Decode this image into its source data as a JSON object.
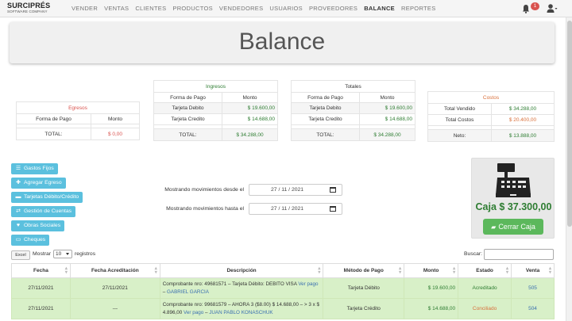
{
  "nav": {
    "brand_name": "SURCIPRÉS",
    "brand_tagline": "SOFTWARE COMPANY",
    "items": [
      "VENDER",
      "VENTAS",
      "CLIENTES",
      "PRODUCTOS",
      "VENDEDORES",
      "USUARIOS",
      "PROVEEDORES",
      "BALANCE",
      "REPORTES"
    ],
    "active": "BALANCE",
    "notification_count": "1"
  },
  "page_title": "Balance",
  "egresos": {
    "title": "Egresos",
    "col1": "Forma de Pago",
    "col2": "Monto",
    "total_label": "TOTAL:",
    "total_value": "$ 0,00"
  },
  "ingresos": {
    "title": "Ingresos",
    "col1": "Forma de Pago",
    "col2": "Monto",
    "rows": [
      {
        "forma": "Tarjeta Debito",
        "monto": "$ 19.600,00"
      },
      {
        "forma": "Tarjeta Credito",
        "monto": "$ 14.688,00"
      }
    ],
    "total_label": "TOTAL:",
    "total_value": "$ 34.288,00"
  },
  "totales": {
    "title": "Totales",
    "col1": "Forma de Pago",
    "col2": "Monto",
    "rows": [
      {
        "forma": "Tarjeta Debito",
        "monto": "$ 19.600,00"
      },
      {
        "forma": "Tarjeta Credito",
        "monto": "$ 14.688,00"
      }
    ],
    "total_label": "TOTAL:",
    "total_value": "$ 34.288,00"
  },
  "costos": {
    "title": "Costos",
    "rows": [
      {
        "label": "Total Vendido",
        "value": "$ 34.288,00"
      },
      {
        "label": "Total Costos",
        "value": "$ 20.400,00"
      }
    ],
    "neto_label": "Neto:",
    "neto_value": "$ 13.888,00"
  },
  "actions": {
    "gastos_fijos": "Gastos Fijos",
    "agregar_egreso": "Agregar Egreso",
    "tarjetas": "Tarjetas Débito/Crédito",
    "gestion_cuentas": "Gestión de Cuentas",
    "obras_sociales": "Obras Sociales",
    "cheques": "Cheques"
  },
  "filters": {
    "desde_label": "Mostrando movimientos desde el",
    "desde_value": "27 / 11 / 2021",
    "hasta_label": "Mostrando movimientos hasta el",
    "hasta_value": "27 / 11 / 2021"
  },
  "caja": {
    "total": "Caja  $ 37.300,00",
    "cerrar_label": "Cerrar Caja"
  },
  "table_controls": {
    "excel": "Excel",
    "mostrar": "Mostrar",
    "page_size": "10",
    "registros": "registros",
    "buscar": "Buscar:"
  },
  "movimientos": {
    "columns": [
      "Fecha",
      "Fecha Acreditación",
      "Descripción",
      "Método de Pago",
      "Monto",
      "Estado",
      "Venta"
    ],
    "rows": [
      {
        "fecha": "27/11/2021",
        "acreditacion": "27/11/2021",
        "desc_text": "Comprobante nro: 49681571 – Tarjeta Débito: DEBITO VISA ",
        "desc_link": "Ver pago",
        "desc_suffix": " – ",
        "desc_client": "GABRIEL GARCIA",
        "metodo": "Tarjeta Débito",
        "monto": "$ 19.600,00",
        "estado": "Acreditado",
        "venta": "505"
      },
      {
        "fecha": "27/11/2021",
        "acreditacion": "---",
        "desc_text": "Comprobante nro: 99681579 – AHORA 3 ($8.00) $ 14.688,00 – > 3 x $ 4.896,00 ",
        "desc_link": "Ver pago",
        "desc_suffix": " – ",
        "desc_client": "JUAN PABLO KONASCHUK",
        "metodo": "Tarjeta Crédito",
        "monto": "$ 14.688,00",
        "estado": "Conciliado",
        "venta": "504"
      }
    ]
  },
  "colors": {
    "accent_info": "#5bc0de",
    "success": "#5cb85c",
    "money_green": "#2e7d32",
    "danger": "#d9534f",
    "row_green": "#d8f0c8"
  }
}
